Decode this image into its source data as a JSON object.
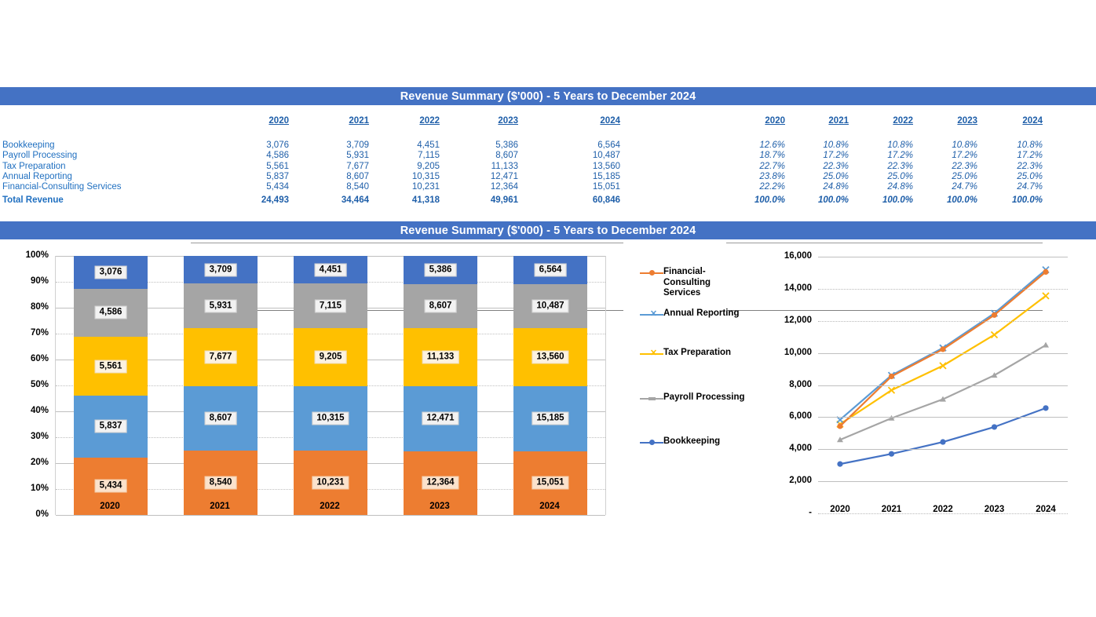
{
  "banners": {
    "top": "Revenue Summary ($'000) - 5 Years to December 2024",
    "bottom": "Revenue Summary ($'000) - 5 Years to December 2024"
  },
  "colors": {
    "banner": "#4472C4",
    "text_blue": "#1F5FA9",
    "bookkeeping": "#4472C4",
    "payroll_processing": "#A5A5A5",
    "tax_preparation": "#FFC000",
    "annual_reporting": "#5B9BD5",
    "financial_consulting": "#ED7D31"
  },
  "table_values": {
    "columns": [
      "2020",
      "2021",
      "2022",
      "2023",
      "2024"
    ],
    "rows": [
      {
        "label": "Bookkeeping",
        "values": [
          "3,076",
          "3,709",
          "4,451",
          "5,386",
          "6,564"
        ]
      },
      {
        "label": "Payroll Processing",
        "values": [
          "4,586",
          "5,931",
          "7,115",
          "8,607",
          "10,487"
        ]
      },
      {
        "label": "Tax Preparation",
        "values": [
          "5,561",
          "7,677",
          "9,205",
          "11,133",
          "13,560"
        ]
      },
      {
        "label": "Annual Reporting",
        "values": [
          "5,837",
          "8,607",
          "10,315",
          "12,471",
          "15,185"
        ]
      },
      {
        "label": "Financial-Consulting Services",
        "values": [
          "5,434",
          "8,540",
          "10,231",
          "12,364",
          "15,051"
        ]
      }
    ],
    "total": {
      "label": "Total Revenue",
      "values": [
        "24,493",
        "34,464",
        "41,318",
        "49,961",
        "60,846"
      ]
    }
  },
  "table_percent": {
    "columns": [
      "2020",
      "2021",
      "2022",
      "2023",
      "2024"
    ],
    "rows": [
      {
        "label": "Bookkeeping",
        "values": [
          "12.6%",
          "10.8%",
          "10.8%",
          "10.8%",
          "10.8%"
        ]
      },
      {
        "label": "Payroll Processing",
        "values": [
          "18.7%",
          "17.2%",
          "17.2%",
          "17.2%",
          "17.2%"
        ]
      },
      {
        "label": "Tax Preparation",
        "values": [
          "22.7%",
          "22.3%",
          "22.3%",
          "22.3%",
          "22.3%"
        ]
      },
      {
        "label": "Annual Reporting",
        "values": [
          "23.8%",
          "25.0%",
          "25.0%",
          "25.0%",
          "25.0%"
        ]
      },
      {
        "label": "Financial-Consulting Services",
        "values": [
          "22.2%",
          "24.8%",
          "24.8%",
          "24.7%",
          "24.7%"
        ]
      }
    ],
    "total": {
      "label": "Total",
      "values": [
        "100.0%",
        "100.0%",
        "100.0%",
        "100.0%",
        "100.0%"
      ]
    }
  },
  "chart_data": [
    {
      "type": "bar",
      "stacked": true,
      "normalized": true,
      "title": "Revenue Summary ($'000) - 5 Years to December 2024",
      "xlabel": "",
      "ylabel": "",
      "categories": [
        "2020",
        "2021",
        "2022",
        "2023",
        "2024"
      ],
      "ylim": [
        0,
        100
      ],
      "ytick_labels": [
        "0%",
        "10%",
        "20%",
        "30%",
        "40%",
        "50%",
        "60%",
        "70%",
        "80%",
        "90%",
        "100%"
      ],
      "grid": true,
      "legend_position": "right",
      "series": [
        {
          "name": "Financial-Consulting Services",
          "color": "#ED7D31",
          "values": [
            5434,
            8540,
            10231,
            12364,
            15051
          ],
          "labels": [
            "5,434",
            "8,540",
            "10,231",
            "12,364",
            "15,051"
          ],
          "percent": [
            22.2,
            24.8,
            24.8,
            24.7,
            24.7
          ]
        },
        {
          "name": "Annual Reporting",
          "color": "#5B9BD5",
          "values": [
            5837,
            8607,
            10315,
            12471,
            15185
          ],
          "labels": [
            "5,837",
            "8,607",
            "10,315",
            "12,471",
            "15,185"
          ],
          "percent": [
            23.8,
            25.0,
            25.0,
            25.0,
            25.0
          ]
        },
        {
          "name": "Tax Preparation",
          "color": "#FFC000",
          "values": [
            5561,
            7677,
            9205,
            11133,
            13560
          ],
          "labels": [
            "5,561",
            "7,677",
            "9,205",
            "11,133",
            "13,560"
          ],
          "percent": [
            22.7,
            22.3,
            22.3,
            22.3,
            22.3
          ]
        },
        {
          "name": "Payroll Processing",
          "color": "#A5A5A5",
          "values": [
            4586,
            5931,
            7115,
            8607,
            10487
          ],
          "labels": [
            "4,586",
            "5,931",
            "7,115",
            "8,607",
            "10,487"
          ],
          "percent": [
            18.7,
            17.2,
            17.2,
            17.2,
            17.2
          ]
        },
        {
          "name": "Bookkeeping",
          "color": "#4472C4",
          "values": [
            3076,
            3709,
            4451,
            5386,
            6564
          ],
          "labels": [
            "3,076",
            "3,709",
            "4,451",
            "5,386",
            "6,564"
          ],
          "percent": [
            12.6,
            10.8,
            10.8,
            10.8,
            10.8
          ]
        }
      ]
    },
    {
      "type": "line",
      "title": "",
      "xlabel": "",
      "ylabel": "",
      "x": [
        "2020",
        "2021",
        "2022",
        "2023",
        "2024"
      ],
      "ylim": [
        0,
        16000
      ],
      "ytick_labels": [
        "-",
        "2,000",
        "4,000",
        "6,000",
        "8,000",
        "10,000",
        "12,000",
        "14,000",
        "16,000"
      ],
      "grid": true,
      "legend_position": "none",
      "series": [
        {
          "name": "Financial-Consulting Services",
          "color": "#ED7D31",
          "marker": "circle",
          "values": [
            5434,
            8540,
            10231,
            12364,
            15051
          ]
        },
        {
          "name": "Annual Reporting",
          "color": "#5B9BD5",
          "marker": "x",
          "values": [
            5837,
            8607,
            10315,
            12471,
            15185
          ]
        },
        {
          "name": "Tax Preparation",
          "color": "#FFC000",
          "marker": "x",
          "values": [
            5561,
            7677,
            9205,
            11133,
            13560
          ]
        },
        {
          "name": "Payroll Processing",
          "color": "#A5A5A5",
          "marker": "triangle",
          "values": [
            4586,
            5931,
            7115,
            8607,
            10487
          ]
        },
        {
          "name": "Bookkeeping",
          "color": "#4472C4",
          "marker": "circle",
          "values": [
            3076,
            3709,
            4451,
            5386,
            6564
          ]
        }
      ]
    }
  ],
  "legend": {
    "items": [
      {
        "label": "Financial-Consulting Services",
        "color": "#ED7D31",
        "marker": "circle"
      },
      {
        "label": "Annual Reporting",
        "color": "#5B9BD5",
        "marker": "x"
      },
      {
        "label": "Tax Preparation",
        "color": "#FFC000",
        "marker": "x"
      },
      {
        "label": "Payroll Processing",
        "color": "#A5A5A5",
        "marker": "dash"
      },
      {
        "label": "Bookkeeping",
        "color": "#4472C4",
        "marker": "circle"
      }
    ]
  }
}
